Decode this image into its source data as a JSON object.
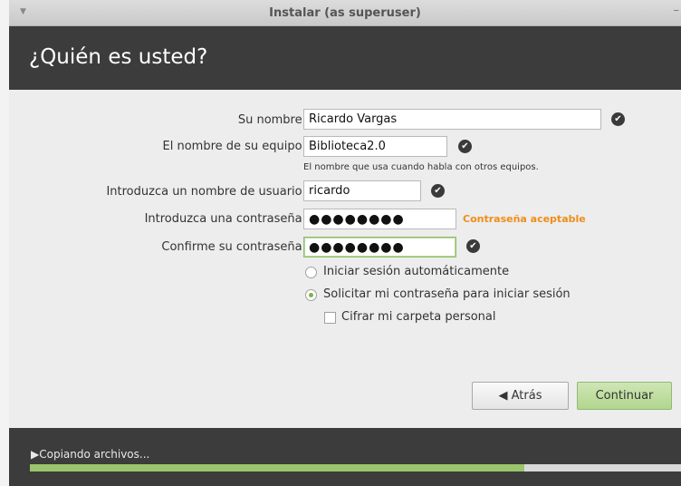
{
  "window": {
    "title": "Instalar (as superuser)"
  },
  "header": {
    "title": "¿Quién es usted?"
  },
  "form": {
    "name": {
      "label": "Su nombre:",
      "value": "Ricardo Vargas"
    },
    "computer": {
      "label": "El nombre de su equipo:",
      "value": "Biblioteca2.0",
      "hint": "El nombre que usa cuando habla con otros equipos."
    },
    "username": {
      "label": "Introduzca un nombre de usuario:",
      "value": "ricardo"
    },
    "password": {
      "label": "Introduzca una contraseña:",
      "value": "●●●●●●●●",
      "strength": "Contraseña aceptable"
    },
    "confirm": {
      "label": "Confirme su contraseña:",
      "value": "●●●●●●●●"
    }
  },
  "login_options": {
    "auto_login": {
      "label": "Iniciar sesión automáticamente",
      "selected": false
    },
    "require_password": {
      "label": "Solicitar mi contraseña para iniciar sesión",
      "selected": true
    },
    "encrypt_home": {
      "label": "Cifrar mi carpeta personal",
      "checked": false
    }
  },
  "buttons": {
    "back": "Atrás",
    "continue": "Continuar"
  },
  "footer": {
    "status": "Copiando archivos...",
    "progress": 0.76
  },
  "colors": {
    "header_bg": "#3c3c3c",
    "accent_green": "#9bc56c",
    "warning_orange": "#f08d19"
  }
}
